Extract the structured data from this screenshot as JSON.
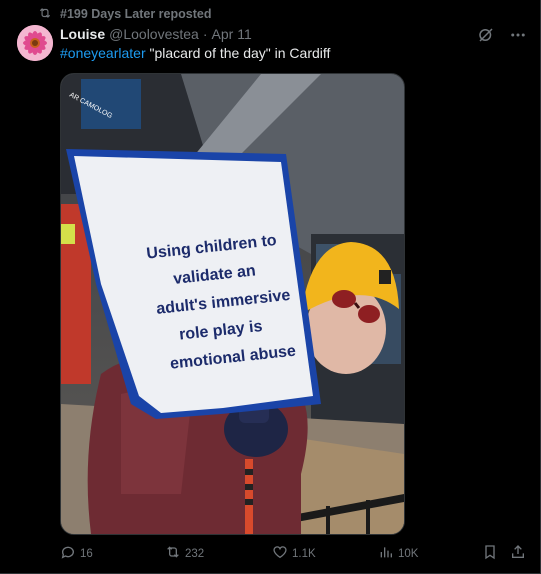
{
  "repost": {
    "label": "#199 Days Later reposted"
  },
  "post": {
    "author_name": "Louise",
    "handle": "@Loolovestea",
    "dot": "·",
    "date": "Apr 11",
    "hashtag": "#oneyearlater",
    "text_rest": " \"placard of the day\" in Cardiff"
  },
  "media": {
    "street_sign": "AR CAMOLOG",
    "placard_lines": [
      "Using children to",
      "validate an",
      "adult's immersive",
      "role play is",
      "emotional abuse"
    ]
  },
  "actions": {
    "replies": "16",
    "reposts": "232",
    "likes": "1.1K",
    "views": "10K"
  },
  "colors": {
    "background": "#000000",
    "text": "#e7e9ea",
    "muted": "#71767b",
    "link": "#1d9bf0"
  }
}
